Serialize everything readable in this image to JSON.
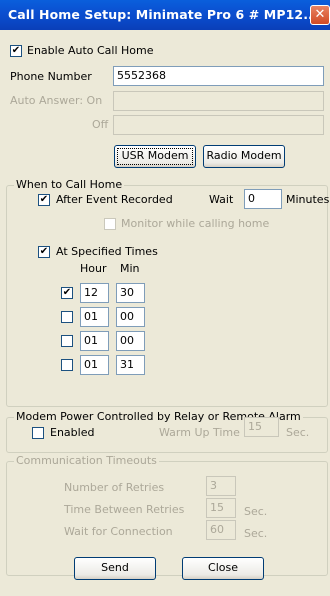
{
  "window": {
    "title": "Call Home Setup: Minimate Pro 6 # MP12...",
    "close_glyph": "✕"
  },
  "enable_auto": {
    "label": "Enable Auto Call Home",
    "checked": true
  },
  "phone": {
    "label": "Phone Number",
    "value": "5552368"
  },
  "auto_answer": {
    "on_label": "Auto Answer: On",
    "off_label": "Off",
    "on_value": "",
    "off_value": ""
  },
  "buttons": {
    "usr_modem": "USR Modem",
    "radio_modem": "Radio Modem",
    "send": "Send",
    "close": "Close"
  },
  "when": {
    "legend": "When to Call Home",
    "after_event": {
      "label": "After Event Recorded",
      "checked": true
    },
    "wait_label": "Wait",
    "wait_value": "0",
    "minutes_label": "Minutes",
    "monitor": {
      "label": "Monitor while calling home",
      "checked": false
    },
    "specified": {
      "label": "At Specified Times",
      "checked": true
    },
    "hour_header": "Hour",
    "min_header": "Min",
    "times": [
      {
        "checked": true,
        "hour": "12",
        "min": "30"
      },
      {
        "checked": false,
        "hour": "01",
        "min": "00"
      },
      {
        "checked": false,
        "hour": "01",
        "min": "00"
      },
      {
        "checked": false,
        "hour": "01",
        "min": "31"
      }
    ]
  },
  "modem_power": {
    "legend": "Modem Power Controlled by Relay or Remote Alarm",
    "enabled": {
      "label": "Enabled",
      "checked": false
    },
    "warmup_label": "Warm Up Time",
    "warmup_value": "15",
    "warmup_unit": "Sec."
  },
  "comm": {
    "legend": "Communication Timeouts",
    "retries_label": "Number of Retries",
    "retries_value": "3",
    "between_label": "Time Between Retries",
    "between_value": "15",
    "between_unit": "Sec.",
    "wait_conn_label": "Wait for Connection",
    "wait_conn_value": "60",
    "wait_conn_unit": "Sec."
  }
}
